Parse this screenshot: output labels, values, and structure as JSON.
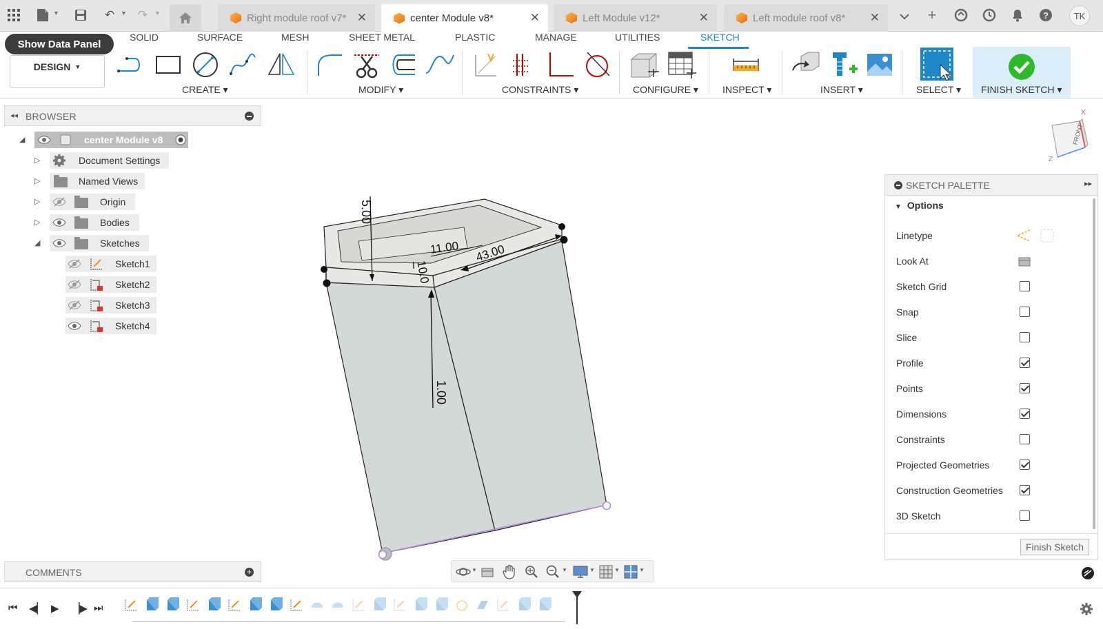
{
  "tabs": {
    "home_label": "",
    "items": [
      {
        "label": "Right module roof v7*",
        "active": false
      },
      {
        "label": "center Module v8*",
        "active": true
      },
      {
        "label": "Left Module v12*",
        "active": false
      },
      {
        "label": "Left module roof v8*",
        "active": false
      }
    ],
    "user_initials": "TK"
  },
  "toolbar": {
    "show_data_panel": "Show Data Panel",
    "workspace": "DESIGN",
    "workspace_tabs": [
      "SOLID",
      "SURFACE",
      "MESH",
      "SHEET METAL",
      "PLASTIC",
      "MANAGE",
      "UTILITIES",
      "SKETCH"
    ],
    "active_tab": "SKETCH",
    "groups": {
      "create": "CREATE",
      "modify": "MODIFY",
      "constraints": "CONSTRAINTS",
      "configure": "CONFIGURE",
      "inspect": "INSPECT",
      "insert": "INSERT",
      "select": "SELECT",
      "finish_sketch": "FINISH SKETCH"
    }
  },
  "browser": {
    "title": "BROWSER",
    "root": "center Module v8",
    "items": [
      {
        "label": "Document Settings",
        "icon": "gear-icon"
      },
      {
        "label": "Named Views",
        "icon": "folder-icon"
      },
      {
        "label": "Origin",
        "icon": "folder-icon"
      },
      {
        "label": "Bodies",
        "icon": "folder-icon"
      },
      {
        "label": "Sketches",
        "icon": "folder-icon"
      }
    ],
    "sketches": [
      "Sketch1",
      "Sketch2",
      "Sketch3",
      "Sketch4"
    ]
  },
  "comments": {
    "title": "COMMENTS"
  },
  "viewport": {
    "dimensions": [
      "5.00",
      "11.00",
      "43.00",
      "10.0",
      "1.00"
    ],
    "viewcube_face": "FRONT",
    "axis_x": "X",
    "axis_z": "Z"
  },
  "palette": {
    "title": "SKETCH PALETTE",
    "section": "Options",
    "rows": [
      {
        "label": "Linetype",
        "type": "icons"
      },
      {
        "label": "Look At",
        "type": "icon"
      },
      {
        "label": "Sketch Grid",
        "type": "check",
        "checked": false
      },
      {
        "label": "Snap",
        "type": "check",
        "checked": false
      },
      {
        "label": "Slice",
        "type": "check",
        "checked": false
      },
      {
        "label": "Profile",
        "type": "check",
        "checked": true
      },
      {
        "label": "Points",
        "type": "check",
        "checked": true
      },
      {
        "label": "Dimensions",
        "type": "check",
        "checked": true
      },
      {
        "label": "Constraints",
        "type": "check",
        "checked": false
      },
      {
        "label": "Projected Geometries",
        "type": "check",
        "checked": true
      },
      {
        "label": "Construction Geometries",
        "type": "check",
        "checked": true
      },
      {
        "label": "3D Sketch",
        "type": "check",
        "checked": false
      }
    ],
    "finish_button": "Finish Sketch"
  },
  "colors": {
    "accent": "#1e88c7",
    "finish_green": "#2eb82e",
    "body_fill": "#d3d9d6",
    "sketch_line": "#b388e6"
  }
}
